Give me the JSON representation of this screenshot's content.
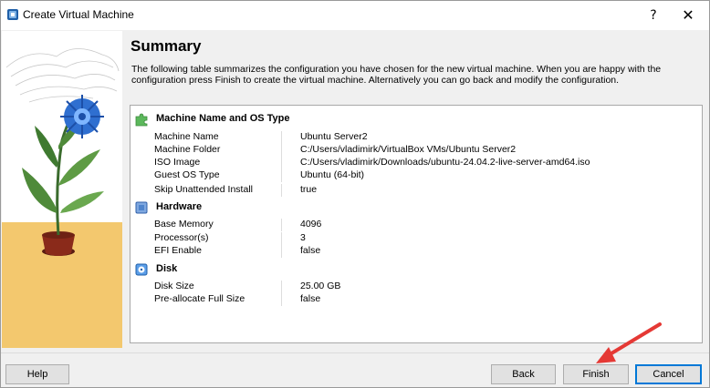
{
  "window": {
    "title": "Create Virtual Machine",
    "help_symbol": "?",
    "close_symbol": "✕"
  },
  "content": {
    "heading": "Summary",
    "description": "The following table summarizes the configuration you have chosen for the new virtual machine. When you are happy with the configuration press Finish to create the virtual machine. Alternatively you can go back and modify the configuration."
  },
  "sections": [
    {
      "title": "Machine Name and OS Type",
      "icon": "puzzle-icon",
      "rows": [
        {
          "key": "Machine Name",
          "value": "Ubuntu Server2"
        },
        {
          "key": "Machine Folder",
          "value": "C:/Users/vladimirk/VirtualBox VMs/Ubuntu Server2"
        },
        {
          "key": "ISO Image",
          "value": "C:/Users/vladimirk/Downloads/ubuntu-24.04.2-live-server-amd64.iso"
        },
        {
          "key": "Guest OS Type",
          "value": "Ubuntu (64-bit)"
        },
        {
          "key": "Skip Unattended Install",
          "value": "true"
        }
      ]
    },
    {
      "title": "Hardware",
      "icon": "chip-icon",
      "rows": [
        {
          "key": "Base Memory",
          "value": "4096"
        },
        {
          "key": "Processor(s)",
          "value": "3"
        },
        {
          "key": "EFI Enable",
          "value": "false"
        }
      ]
    },
    {
      "title": "Disk",
      "icon": "disk-icon",
      "rows": [
        {
          "key": "Disk Size",
          "value": "25.00 GB"
        },
        {
          "key": "Pre-allocate Full Size",
          "value": "false"
        }
      ]
    }
  ],
  "buttons": {
    "help": "Help",
    "back": "Back",
    "finish": "Finish",
    "cancel": "Cancel"
  },
  "colors": {
    "accent_blue": "#0078d7",
    "arrow_red": "#e53935",
    "flower_blue": "#2f6fd0",
    "art_floor": "#f3c86e"
  }
}
